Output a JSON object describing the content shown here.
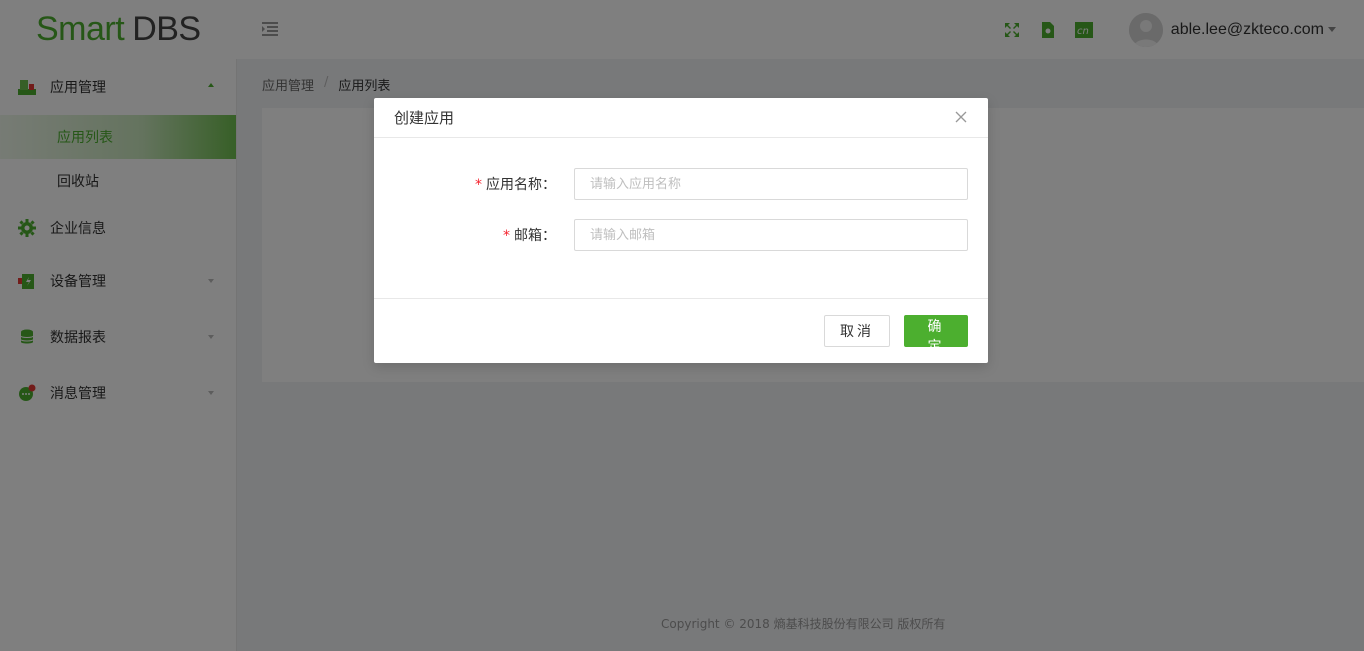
{
  "header": {
    "logo_part1": "Smart",
    "logo_part2": "DBS",
    "user_email": "able.lee@zkteco.com",
    "lang_label": "cn"
  },
  "sidebar": {
    "items": [
      {
        "label": "应用管理",
        "icon": "app-management-icon",
        "expanded": true
      },
      {
        "label": "企业信息",
        "icon": "gear-icon"
      },
      {
        "label": "设备管理",
        "icon": "device-icon"
      },
      {
        "label": "数据报表",
        "icon": "database-icon"
      },
      {
        "label": "消息管理",
        "icon": "message-icon"
      }
    ],
    "sub_items": [
      {
        "label": "应用列表",
        "active": true
      },
      {
        "label": "回收站"
      }
    ]
  },
  "breadcrumb": {
    "root": "应用管理",
    "separator": "/",
    "current": "应用列表"
  },
  "footer": {
    "copyright": "Copyright © 2018 熵基科技股份有限公司 版权所有"
  },
  "dialog": {
    "title": "创建应用",
    "fields": [
      {
        "label": "应用名称",
        "required_mark": "*",
        "colon": "：",
        "placeholder": "请输入应用名称",
        "value": ""
      },
      {
        "label": "邮箱",
        "required_mark": "*",
        "colon": "：",
        "placeholder": "请输入邮箱",
        "value": ""
      }
    ],
    "cancel_label": "取消",
    "ok_label": "确定"
  },
  "colors": {
    "brand": "#4caf2f",
    "required": "#f5222d"
  }
}
